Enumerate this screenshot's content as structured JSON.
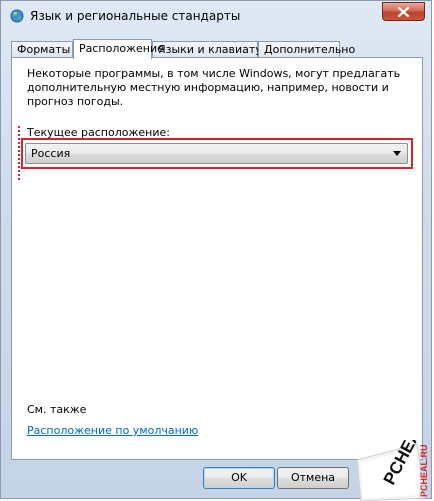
{
  "window": {
    "title": "Язык и региональные стандарты"
  },
  "tabs": [
    {
      "label": "Форматы"
    },
    {
      "label": "Расположение"
    },
    {
      "label": "Языки и клавиатуры"
    },
    {
      "label": "Дополнительно"
    }
  ],
  "active_tab": "Расположение",
  "location": {
    "description": "Некоторые программы, в том числе Windows, могут предлагать дополнительную местную информацию, например, новости и прогноз погоды.",
    "current_label": "Текущее расположение:",
    "current_value": "Россия",
    "see_also": "См. также",
    "default_link": "Расположение по умолчанию"
  },
  "buttons": {
    "ok": "OK",
    "cancel": "Отмена"
  },
  "watermark": {
    "brand": "PCHEAL",
    "site": "PCHEAL.RU"
  },
  "colors": {
    "highlight": "#d9232d",
    "link": "#0066cc"
  }
}
